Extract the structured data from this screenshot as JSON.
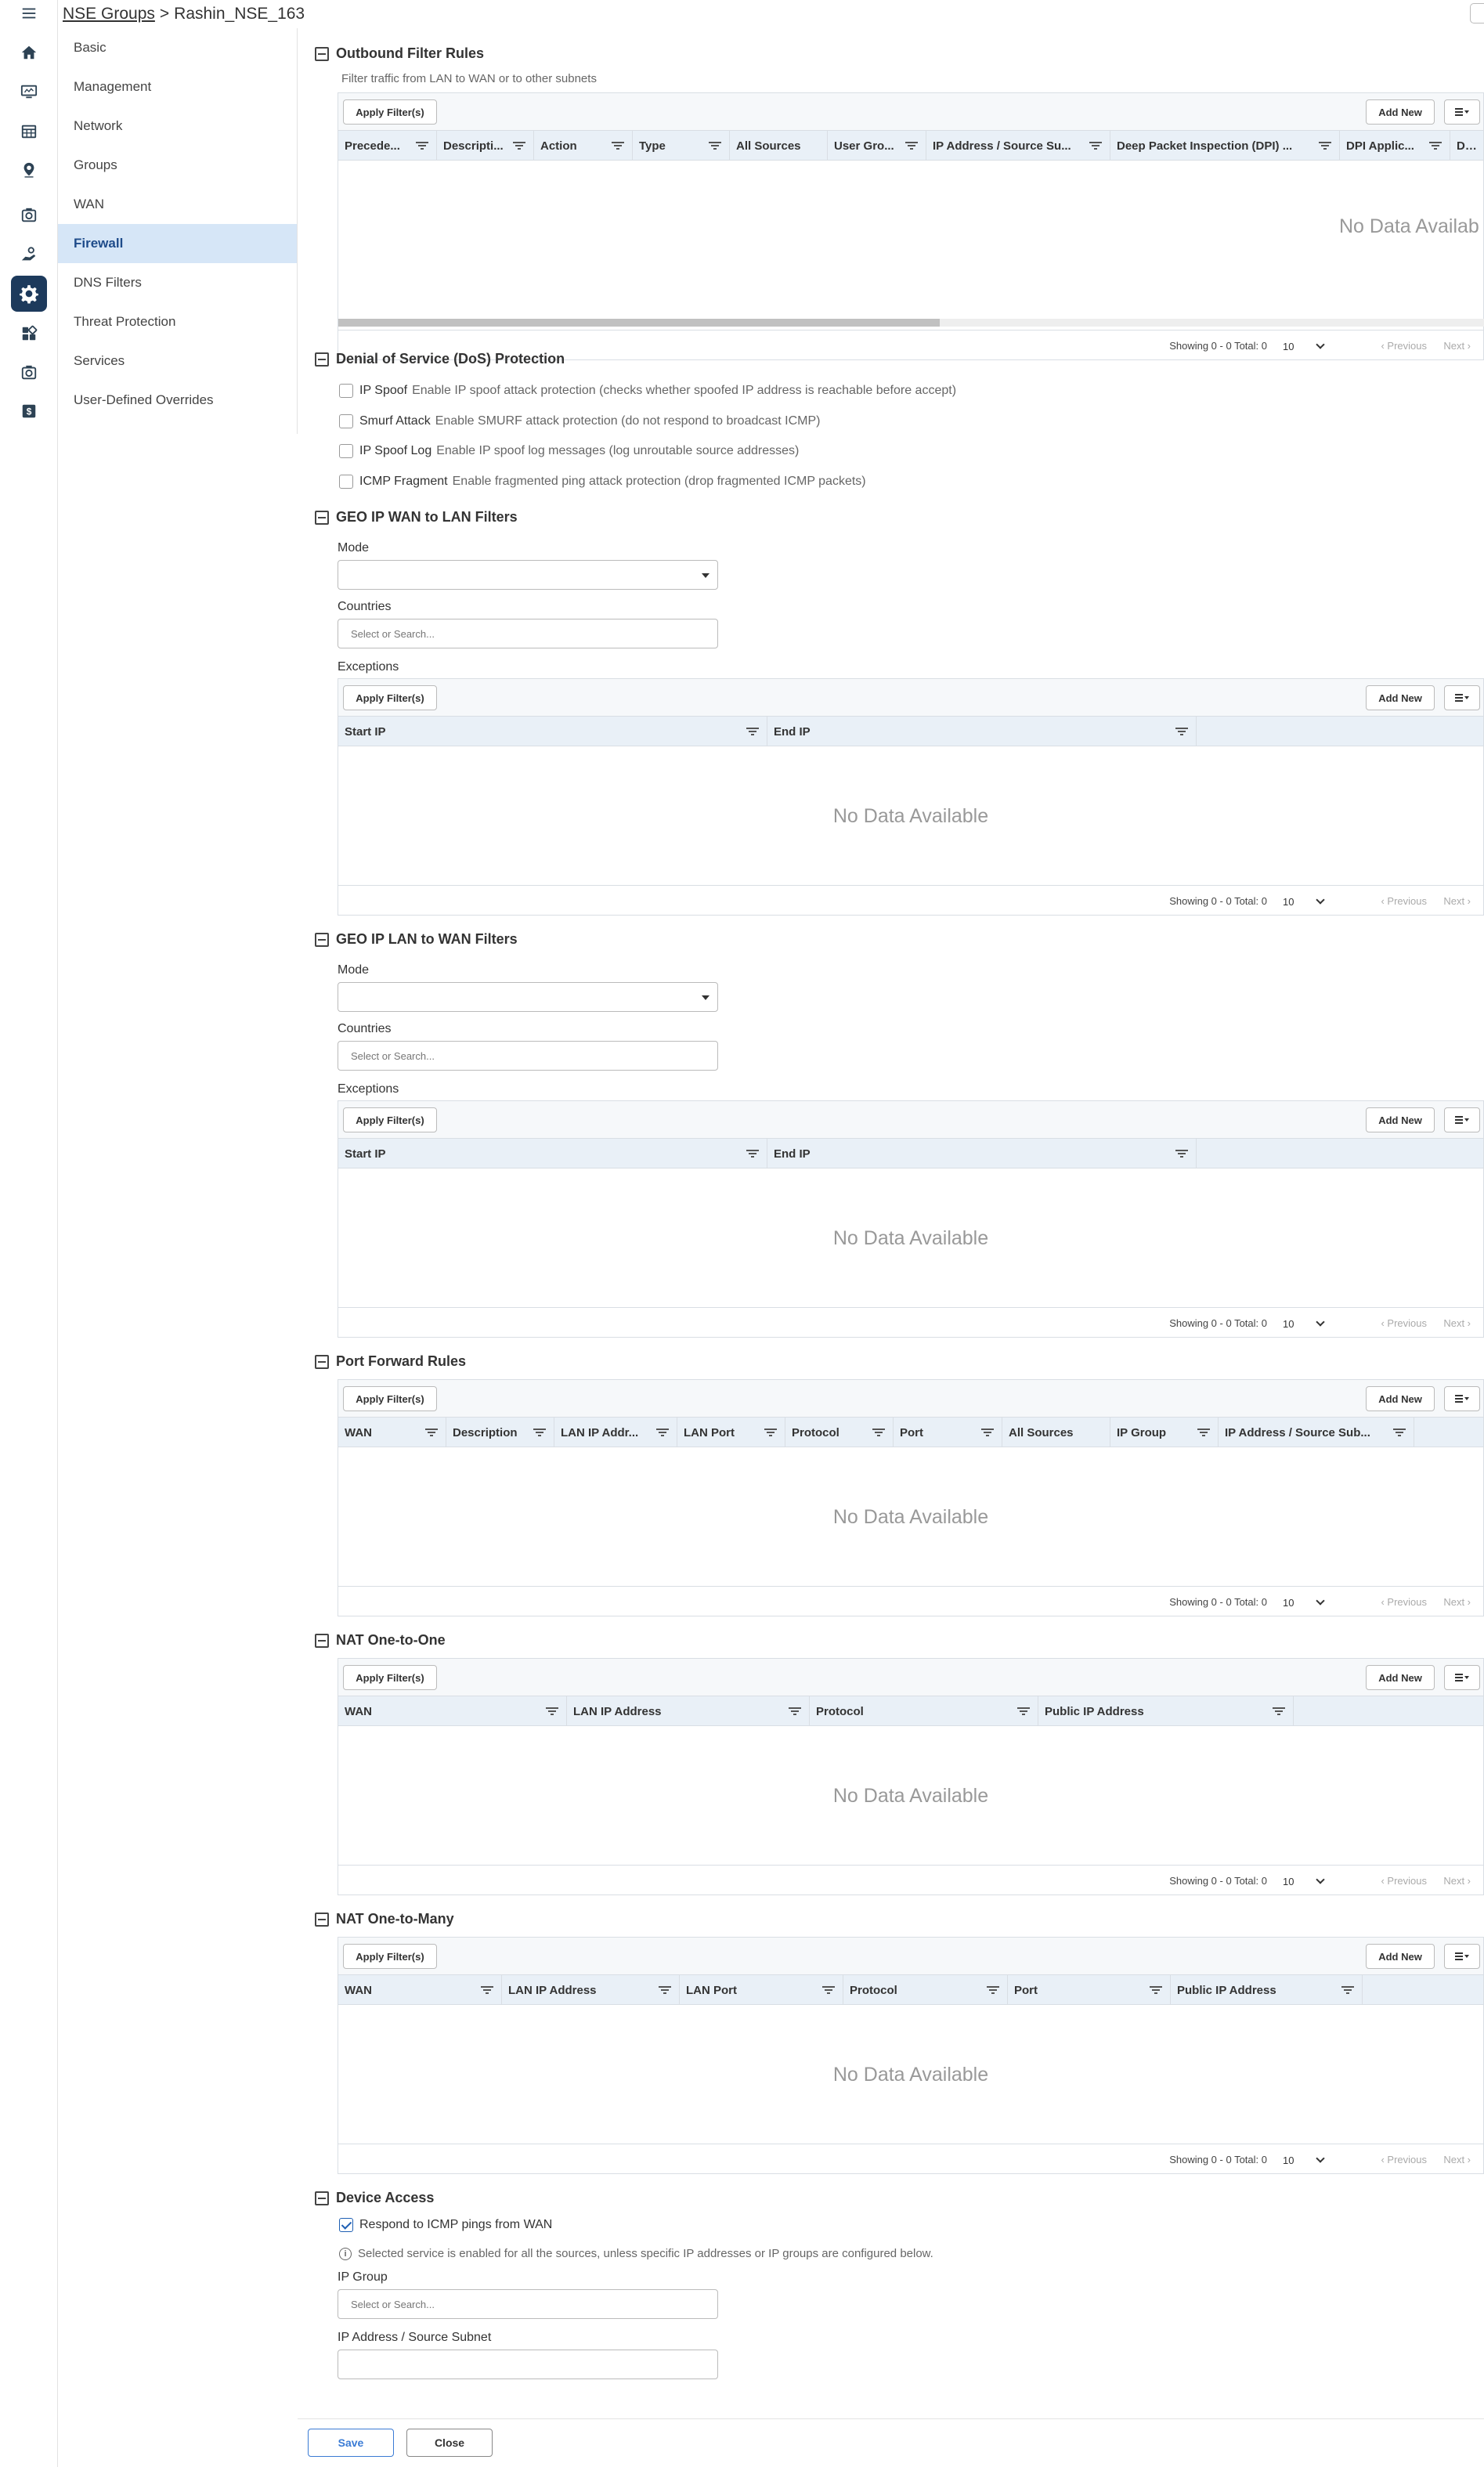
{
  "breadcrumb": {
    "parent": "NSE Groups",
    "separator": ">",
    "current": "Rashin_NSE_163"
  },
  "rail": [
    "menu-icon",
    "home-icon",
    "monitor-icon",
    "table-icon",
    "location-pin-icon",
    "camera-icon",
    "hand-money-icon",
    "gear-icon",
    "apps-icon",
    "camera-icon",
    "dollar-icon"
  ],
  "settings_nav": {
    "items": [
      "Basic",
      "Management",
      "Network",
      "Groups",
      "WAN",
      "Firewall",
      "DNS Filters",
      "Threat Protection",
      "Services",
      "User-Defined Overrides"
    ],
    "active": "Firewall"
  },
  "common": {
    "apply_filters": "Apply Filter(s)",
    "add_new": "Add New",
    "no_data": "No Data Available",
    "showing": "Showing 0 - 0 Total: 0",
    "page_size": "10",
    "previous": "‹ Previous",
    "next": "Next ›",
    "select_or_search": "Select or Search..."
  },
  "outbound": {
    "title": "Outbound Filter Rules",
    "description": "Filter traffic from LAN to WAN or to other subnets",
    "columns": [
      "Precede...",
      "Descripti...",
      "Action",
      "Type",
      "All Sources",
      "User Gro...",
      "IP Address / Source Su...",
      "Deep Packet Inspection (DPI) ...",
      "DPI Applic...",
      "DPI"
    ],
    "no_data": "No Data Availab"
  },
  "dos": {
    "title": "Denial of Service (DoS) Protection",
    "options": [
      {
        "label": "IP Spoof",
        "desc": "Enable IP spoof attack protection (checks whether spoofed IP address is reachable before accept)"
      },
      {
        "label": "Smurf Attack",
        "desc": "Enable SMURF attack protection (do not respond to broadcast ICMP)"
      },
      {
        "label": "IP Spoof Log",
        "desc": "Enable IP spoof log messages (log unroutable source addresses)"
      },
      {
        "label": "ICMP Fragment",
        "desc": "Enable fragmented ping attack protection (drop fragmented ICMP packets)"
      }
    ]
  },
  "geo_wan_lan": {
    "title": "GEO IP WAN to LAN Filters",
    "mode_label": "Mode",
    "countries_label": "Countries",
    "exceptions_label": "Exceptions",
    "columns": [
      "Start IP",
      "End IP"
    ]
  },
  "geo_lan_wan": {
    "title": "GEO IP LAN to WAN Filters",
    "mode_label": "Mode",
    "countries_label": "Countries",
    "exceptions_label": "Exceptions",
    "columns": [
      "Start IP",
      "End IP"
    ]
  },
  "port_forward": {
    "title": "Port Forward Rules",
    "columns": [
      "WAN",
      "Description",
      "LAN IP Addr...",
      "LAN Port",
      "Protocol",
      "Port",
      "All Sources",
      "IP Group",
      "IP Address / Source Sub..."
    ]
  },
  "nat_one": {
    "title": "NAT One-to-One",
    "columns": [
      "WAN",
      "LAN IP Address",
      "Protocol",
      "Public IP Address"
    ]
  },
  "nat_many": {
    "title": "NAT One-to-Many",
    "columns": [
      "WAN",
      "LAN IP Address",
      "LAN Port",
      "Protocol",
      "Port",
      "Public IP Address"
    ]
  },
  "device_access": {
    "title": "Device Access",
    "respond_icmp": "Respond to ICMP pings from WAN",
    "respond_icmp_checked": true,
    "info": "Selected service is enabled for all the sources, unless specific IP addresses or IP groups are configured below.",
    "ip_group_label": "IP Group",
    "ip_address_label": "IP Address / Source Subnet"
  },
  "actions": {
    "save": "Save",
    "close": "Close"
  }
}
